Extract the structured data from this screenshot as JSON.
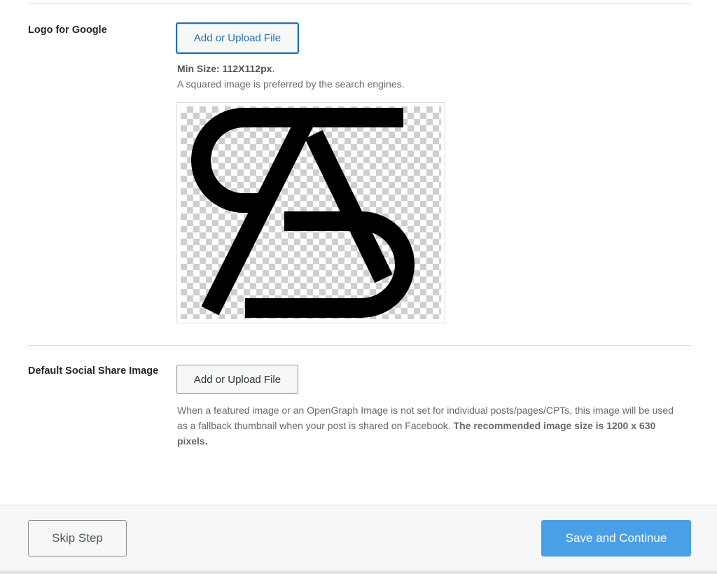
{
  "logo_section": {
    "label": "Logo for Google",
    "button_label": "Add or Upload File",
    "min_size": "Min Size: 112X112px",
    "min_size_suffix": ".",
    "hint": "A squared image is preferred by the search engines."
  },
  "social_section": {
    "label": "Default Social Share Image",
    "button_label": "Add or Upload File",
    "description_plain": "When a featured image or an OpenGraph Image is not set for individual posts/pages/CPTs, this image will be used as a fallback thumbnail when your post is shared on Facebook. ",
    "description_bold": "The recommended image size is 1200 x 630 pixels."
  },
  "footer": {
    "skip_label": "Skip Step",
    "save_label": "Save and Continue"
  },
  "colors": {
    "primary": "#4aa0e6",
    "focus_border": "#2271b1"
  }
}
